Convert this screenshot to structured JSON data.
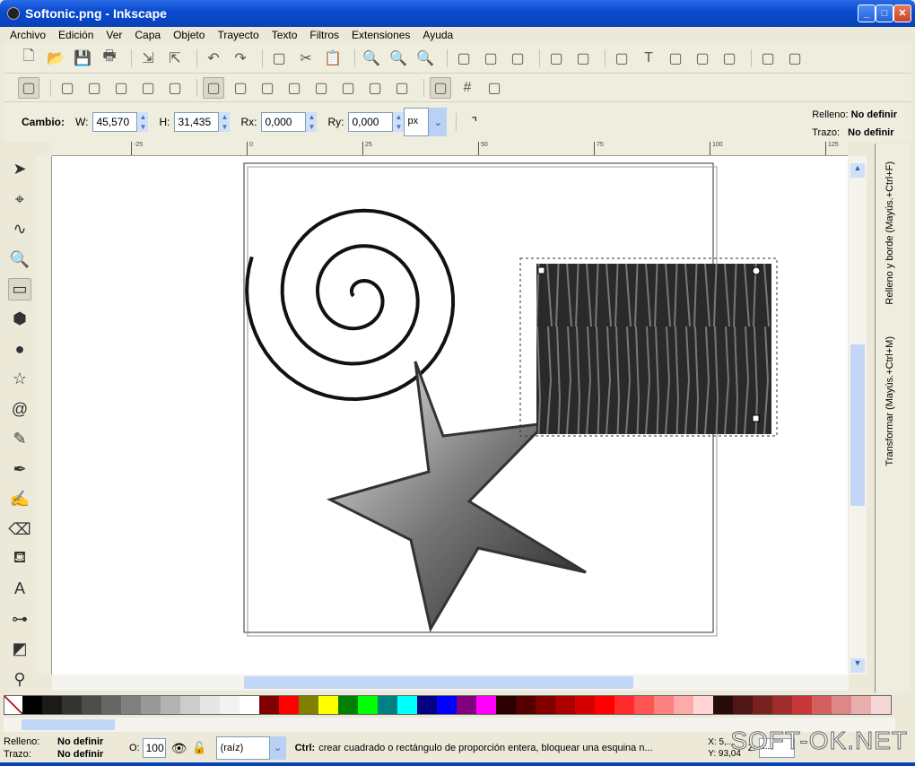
{
  "window": {
    "title": "Softonic.png - Inkscape",
    "controls": [
      "_",
      "□",
      "✕"
    ]
  },
  "menu": [
    "Archivo",
    "Edición",
    "Ver",
    "Capa",
    "Objeto",
    "Trayecto",
    "Texto",
    "Filtros",
    "Extensiones",
    "Ayuda"
  ],
  "toolbar_main": [
    "new-icon",
    "open-icon",
    "save-icon",
    "print-icon",
    "|",
    "import-icon",
    "export-icon",
    "|",
    "undo-icon",
    "redo-icon",
    "|",
    "duplicate-icon",
    "cut-icon",
    "paste-icon",
    "|",
    "zoom-selection-icon",
    "zoom-drawing-icon",
    "zoom-page-icon",
    "|",
    "group-icon",
    "ungroup-icon",
    "clone-icon",
    "|",
    "node-editor-icon",
    "snap-icon",
    "|",
    "fill-stroke-icon",
    "text-tool-icon",
    "layers-icon",
    "xml-editor-icon",
    "align-icon",
    "|",
    "preferences-icon",
    "document-properties-icon"
  ],
  "toolbar_snap": [
    "snap-enable-icon",
    "|",
    "snap-bbox-icon",
    "snap-bbox-edge-icon",
    "snap-bbox-corner-icon",
    "snap-bbox-midpoint-icon",
    "snap-bbox-center-icon",
    "|",
    "snap-nodes-icon",
    "snap-path-icon",
    "snap-intersection-icon",
    "snap-smooth-icon",
    "snap-midpoint-icon",
    "snap-object-center-icon",
    "snap-rotation-center-icon",
    "snap-guide-icon",
    "|",
    "snap-page-icon",
    "snap-grid-icon",
    "snap-guides-icon"
  ],
  "rect_controls": {
    "label": "Cambio:",
    "w_label": "W:",
    "w": "45,570",
    "h_label": "H:",
    "h": "31,435",
    "rx_label": "Rx:",
    "rx": "0,000",
    "ry_label": "Ry:",
    "ry": "0,000",
    "unit": "px"
  },
  "style_indicator": {
    "fill_label": "Relleno:",
    "fill": "No definir",
    "stroke_label": "Trazo:",
    "stroke": "No definir"
  },
  "ruler_labels": [
    "-25",
    "0",
    "25",
    "50",
    "75",
    "100",
    "125"
  ],
  "tools": [
    "selector-icon",
    "node-icon",
    "tweak-icon",
    "zoom-icon",
    "rectangle-icon",
    "3d-box-icon",
    "ellipse-icon",
    "star-icon",
    "spiral-icon",
    "pencil-icon",
    "pen-icon",
    "calligraphy-icon",
    "eraser-icon",
    "paint-bucket-icon",
    "text-icon",
    "connector-icon",
    "gradient-icon",
    "dropper-icon"
  ],
  "dock": {
    "fill_stroke_tab": "Relleno y borde (Mayús.+Ctrl+F)",
    "transform_tab": "Transformar (Mayús.+Ctrl+M)"
  },
  "palette": [
    "#000000",
    "#1a1a1a",
    "#333333",
    "#4d4d4d",
    "#666666",
    "#808080",
    "#999999",
    "#b3b3b3",
    "#cccccc",
    "#e6e6e6",
    "#f2f2f2",
    "#ffffff",
    "#800000",
    "#ff0000",
    "#808000",
    "#ffff00",
    "#008000",
    "#00ff00",
    "#008080",
    "#00ffff",
    "#000080",
    "#0000ff",
    "#800080",
    "#ff00ff",
    "#2b0000",
    "#550000",
    "#800000",
    "#aa0000",
    "#d40000",
    "#ff0000",
    "#ff2a2a",
    "#ff5555",
    "#ff8080",
    "#ffaaaa",
    "#ffd5d5",
    "#280b0b",
    "#501616",
    "#782121",
    "#a02c2c",
    "#c83737",
    "#d35f5f",
    "#de8787",
    "#e9afaf",
    "#f4d7d7"
  ],
  "status": {
    "fill_label": "Relleno:",
    "fill": "No definir",
    "stroke_label": "Trazo:",
    "stroke": "No definir",
    "opacity_label": "O:",
    "opacity": "100",
    "layer": "(raíz)",
    "message_key": "Ctrl:",
    "message": "crear cuadrado o rectángulo de proporción entera, bloquear una esquina n...",
    "x_label": "X:",
    "x": "5,...",
    "y_label": "Y:",
    "y": "93,04",
    "zoom_label": "Z:",
    "zoom": "..."
  },
  "watermark": "SOFT-OK.NET"
}
